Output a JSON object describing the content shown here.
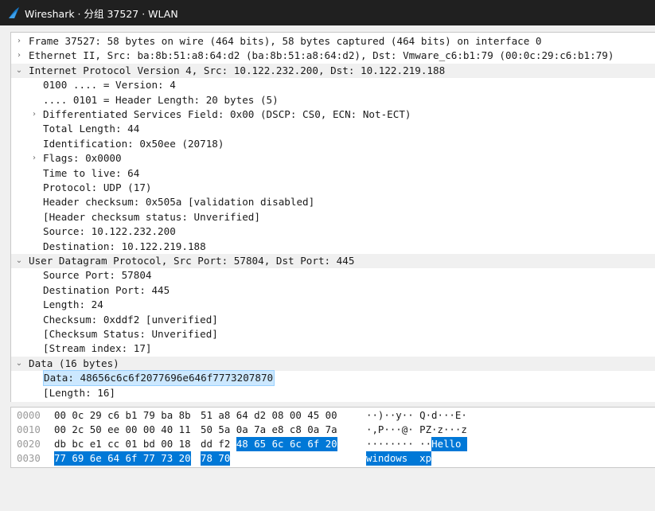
{
  "window": {
    "title": "Wireshark · 分组 37527 · WLAN"
  },
  "tree": [
    {
      "text": "Frame 37527: 58 bytes on wire (464 bits), 58 bytes captured (464 bits) on interface 0",
      "toggle": "›",
      "indent": 0,
      "hdr": false
    },
    {
      "text": "Ethernet II, Src: ba:8b:51:a8:64:d2 (ba:8b:51:a8:64:d2), Dst: Vmware_c6:b1:79 (00:0c:29:c6:b1:79)",
      "toggle": "›",
      "indent": 0,
      "hdr": false
    },
    {
      "text": "Internet Protocol Version 4, Src: 10.122.232.200, Dst: 10.122.219.188",
      "toggle": "⌄",
      "indent": 0,
      "hdr": true
    },
    {
      "text": "0100 .... = Version: 4",
      "toggle": "",
      "indent": 1,
      "hdr": false
    },
    {
      "text": ".... 0101 = Header Length: 20 bytes (5)",
      "toggle": "",
      "indent": 1,
      "hdr": false
    },
    {
      "text": "Differentiated Services Field: 0x00 (DSCP: CS0, ECN: Not-ECT)",
      "toggle": "›",
      "indent": 1,
      "hdr": false
    },
    {
      "text": "Total Length: 44",
      "toggle": "",
      "indent": 1,
      "hdr": false
    },
    {
      "text": "Identification: 0x50ee (20718)",
      "toggle": "",
      "indent": 1,
      "hdr": false
    },
    {
      "text": "Flags: 0x0000",
      "toggle": "›",
      "indent": 1,
      "hdr": false
    },
    {
      "text": "Time to live: 64",
      "toggle": "",
      "indent": 1,
      "hdr": false
    },
    {
      "text": "Protocol: UDP (17)",
      "toggle": "",
      "indent": 1,
      "hdr": false
    },
    {
      "text": "Header checksum: 0x505a [validation disabled]",
      "toggle": "",
      "indent": 1,
      "hdr": false
    },
    {
      "text": "[Header checksum status: Unverified]",
      "toggle": "",
      "indent": 1,
      "hdr": false
    },
    {
      "text": "Source: 10.122.232.200",
      "toggle": "",
      "indent": 1,
      "hdr": false
    },
    {
      "text": "Destination: 10.122.219.188",
      "toggle": "",
      "indent": 1,
      "hdr": false
    },
    {
      "text": "User Datagram Protocol, Src Port: 57804, Dst Port: 445",
      "toggle": "⌄",
      "indent": 0,
      "hdr": true
    },
    {
      "text": "Source Port: 57804",
      "toggle": "",
      "indent": 1,
      "hdr": false
    },
    {
      "text": "Destination Port: 445",
      "toggle": "",
      "indent": 1,
      "hdr": false
    },
    {
      "text": "Length: 24",
      "toggle": "",
      "indent": 1,
      "hdr": false
    },
    {
      "text": "Checksum: 0xddf2 [unverified]",
      "toggle": "",
      "indent": 1,
      "hdr": false
    },
    {
      "text": "[Checksum Status: Unverified]",
      "toggle": "",
      "indent": 1,
      "hdr": false
    },
    {
      "text": "[Stream index: 17]",
      "toggle": "",
      "indent": 1,
      "hdr": false
    },
    {
      "text": "Data (16 bytes)",
      "toggle": "⌄",
      "indent": 0,
      "hdr": true
    },
    {
      "text": "Data: 48656c6c6f2077696e646f7773207870",
      "toggle": "",
      "indent": 1,
      "hdr": false,
      "selected": true
    },
    {
      "text": "[Length: 16]",
      "toggle": "",
      "indent": 1,
      "hdr": false
    }
  ],
  "hexdump": [
    {
      "offset": "0000",
      "bytes_a": "00 0c 29 c6 b1 79 ba 8b",
      "bytes_b": "51 a8 64 d2 08 00 45 00",
      "ascii": "··)··y·· Q·d···E·"
    },
    {
      "offset": "0010",
      "bytes_a": "00 2c 50 ee 00 00 40 11",
      "bytes_b": "50 5a 0a 7a e8 c8 0a 7a",
      "ascii": "·,P···@· PZ·z···z"
    },
    {
      "offset": "0020",
      "bytes_a": "db bc e1 cc 01 bd 00 18",
      "bytes_b": "dd f2",
      "bytes_b_hl": "48 65 6c 6c 6f 20",
      "ascii": "········ ··",
      "ascii_hl": "Hello "
    },
    {
      "offset": "0030",
      "bytes_a_hl": "77 69 6e 64 6f 77 73 20",
      "bytes_b_hl": "78 70",
      "ascii_hl": "windows  xp"
    }
  ],
  "colors": {
    "titlebar": "#202020",
    "selection": "#cce8ff",
    "hex_highlight": "#0078d7"
  }
}
